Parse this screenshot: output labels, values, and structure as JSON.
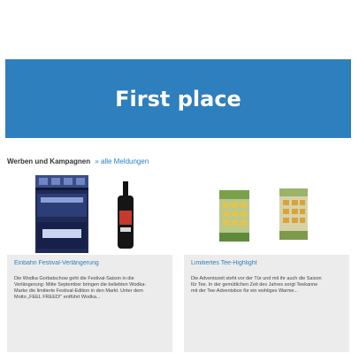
{
  "banner": {
    "title": "First place",
    "color": "#2e7fbd"
  },
  "section": {
    "label": "Werben und Kampagnen",
    "link": "» alle Meldungen"
  },
  "cards": [
    {
      "title": "Einbahn Festival-Verlängerung",
      "description": "Die Wodka Gorbatschow geht die Festival-Saison in die Verlängerung: Mitte September bringen die beliebten Wodka-Marke die limitierte Festival-Edition in den Markt. Unter dem Motto „FEEL FREED!“ entführt Wodka...",
      "image_icon": "product-bottles-image"
    },
    {
      "title": "Limitiertes Tee-Highlight",
      "description": "Die Adventszeit steht vor der Tür und mit ihr auch die Saison für Tee. In der gemütlichen Zeit des Jahres sorgt Teekanne mit der Tee-Adventsbox für ein wohliges Warme...",
      "image_icon": "tea-boxes-image"
    }
  ]
}
